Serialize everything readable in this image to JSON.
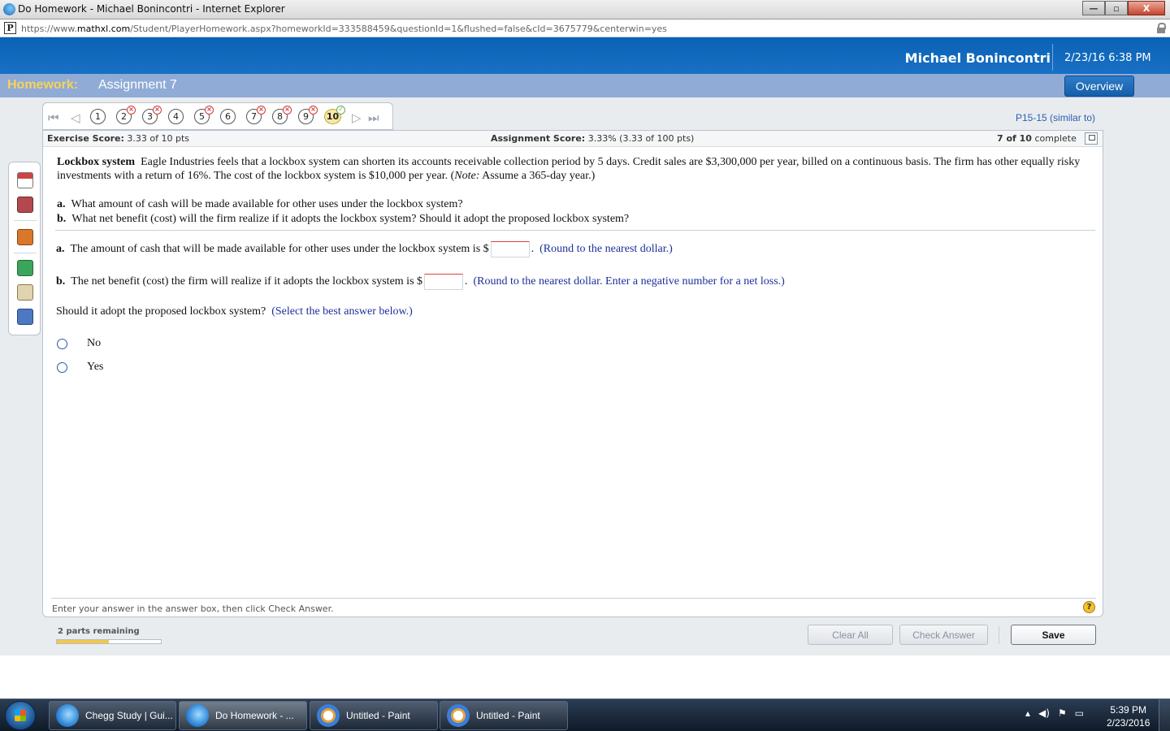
{
  "window": {
    "title": "Do Homework - Michael Bonincontri - Internet Explorer",
    "url_prefix": "https://www.",
    "url_domain": "mathxl.com",
    "url_path": "/Student/PlayerHomework.aspx?homeworkId=333588459&questionId=1&flushed=false&cId=3675779&centerwin=yes",
    "minimize": "—",
    "maximize": "▫",
    "close": "X"
  },
  "header": {
    "user": "Michael Bonincontri",
    "datetime": "2/23/16 6:38 PM",
    "homework_label": "Homework:",
    "assignment": "Assignment 7",
    "overview": "Overview"
  },
  "nav": {
    "questions": [
      {
        "n": "1",
        "mark": ""
      },
      {
        "n": "2",
        "mark": "x"
      },
      {
        "n": "3",
        "mark": "x"
      },
      {
        "n": "4",
        "mark": ""
      },
      {
        "n": "5",
        "mark": "x"
      },
      {
        "n": "6",
        "mark": ""
      },
      {
        "n": "7",
        "mark": "x"
      },
      {
        "n": "8",
        "mark": "x"
      },
      {
        "n": "9",
        "mark": "x"
      },
      {
        "n": "10",
        "mark": "partial"
      }
    ],
    "similar": "P15-15 (similar to)"
  },
  "scores": {
    "exercise_label": "Exercise Score:",
    "exercise_value": "3.33 of 10 pts",
    "assignment_label": "Assignment Score:",
    "assignment_value": "3.33% (3.33 of 100 pts)",
    "complete_bold": "7 of 10",
    "complete_text": "complete"
  },
  "question": {
    "title": "Lockbox system",
    "body1": "Eagle Industries feels that a lockbox system can shorten its accounts receivable collection period by 5 days.  Credit sales are $3,300,000 per year, billed on a continuous basis.  The firm has other equally risky investments with a return of 16%.  The cost of the lockbox system is $10,000 per year.  (",
    "note": "Note:",
    "body2": " Assume a 365-day year.)",
    "a_label": "a.",
    "a_text": "What amount of cash will be made available for other uses under the lockbox system?",
    "b_label": "b.",
    "b_text": "What net benefit (cost) will the firm realize if it adopts the lockbox system?  Should it adopt the proposed lockbox system?"
  },
  "answers": {
    "a_label": "a.",
    "a_text": "The amount of cash that will be made available for other uses under the lockbox system is $",
    "a_period": ".",
    "a_hint": "(Round to the nearest dollar.)",
    "b_label": "b.",
    "b_text": "The net benefit (cost) the firm will realize if it adopts the lockbox system is $",
    "b_period": ".",
    "b_hint": "(Round to the nearest dollar. Enter a negative number for a net loss.)",
    "adopt_text": "Should it adopt the proposed lockbox system?",
    "adopt_hint": "(Select the best answer below.)",
    "options": [
      "No",
      "Yes"
    ]
  },
  "footer": {
    "instruction": "Enter your answer in the answer box, then click Check Answer.",
    "help": "?",
    "parts_remaining": "2 parts remaining",
    "progress_fraction": 0.5,
    "clear_all": "Clear All",
    "check_answer": "Check Answer",
    "save": "Save"
  },
  "taskbar": {
    "tasks": [
      "Chegg Study | Gui...",
      "Do Homework - ...",
      "Untitled - Paint",
      "Untitled - Paint"
    ],
    "time": "5:39 PM",
    "date": "2/23/2016"
  }
}
